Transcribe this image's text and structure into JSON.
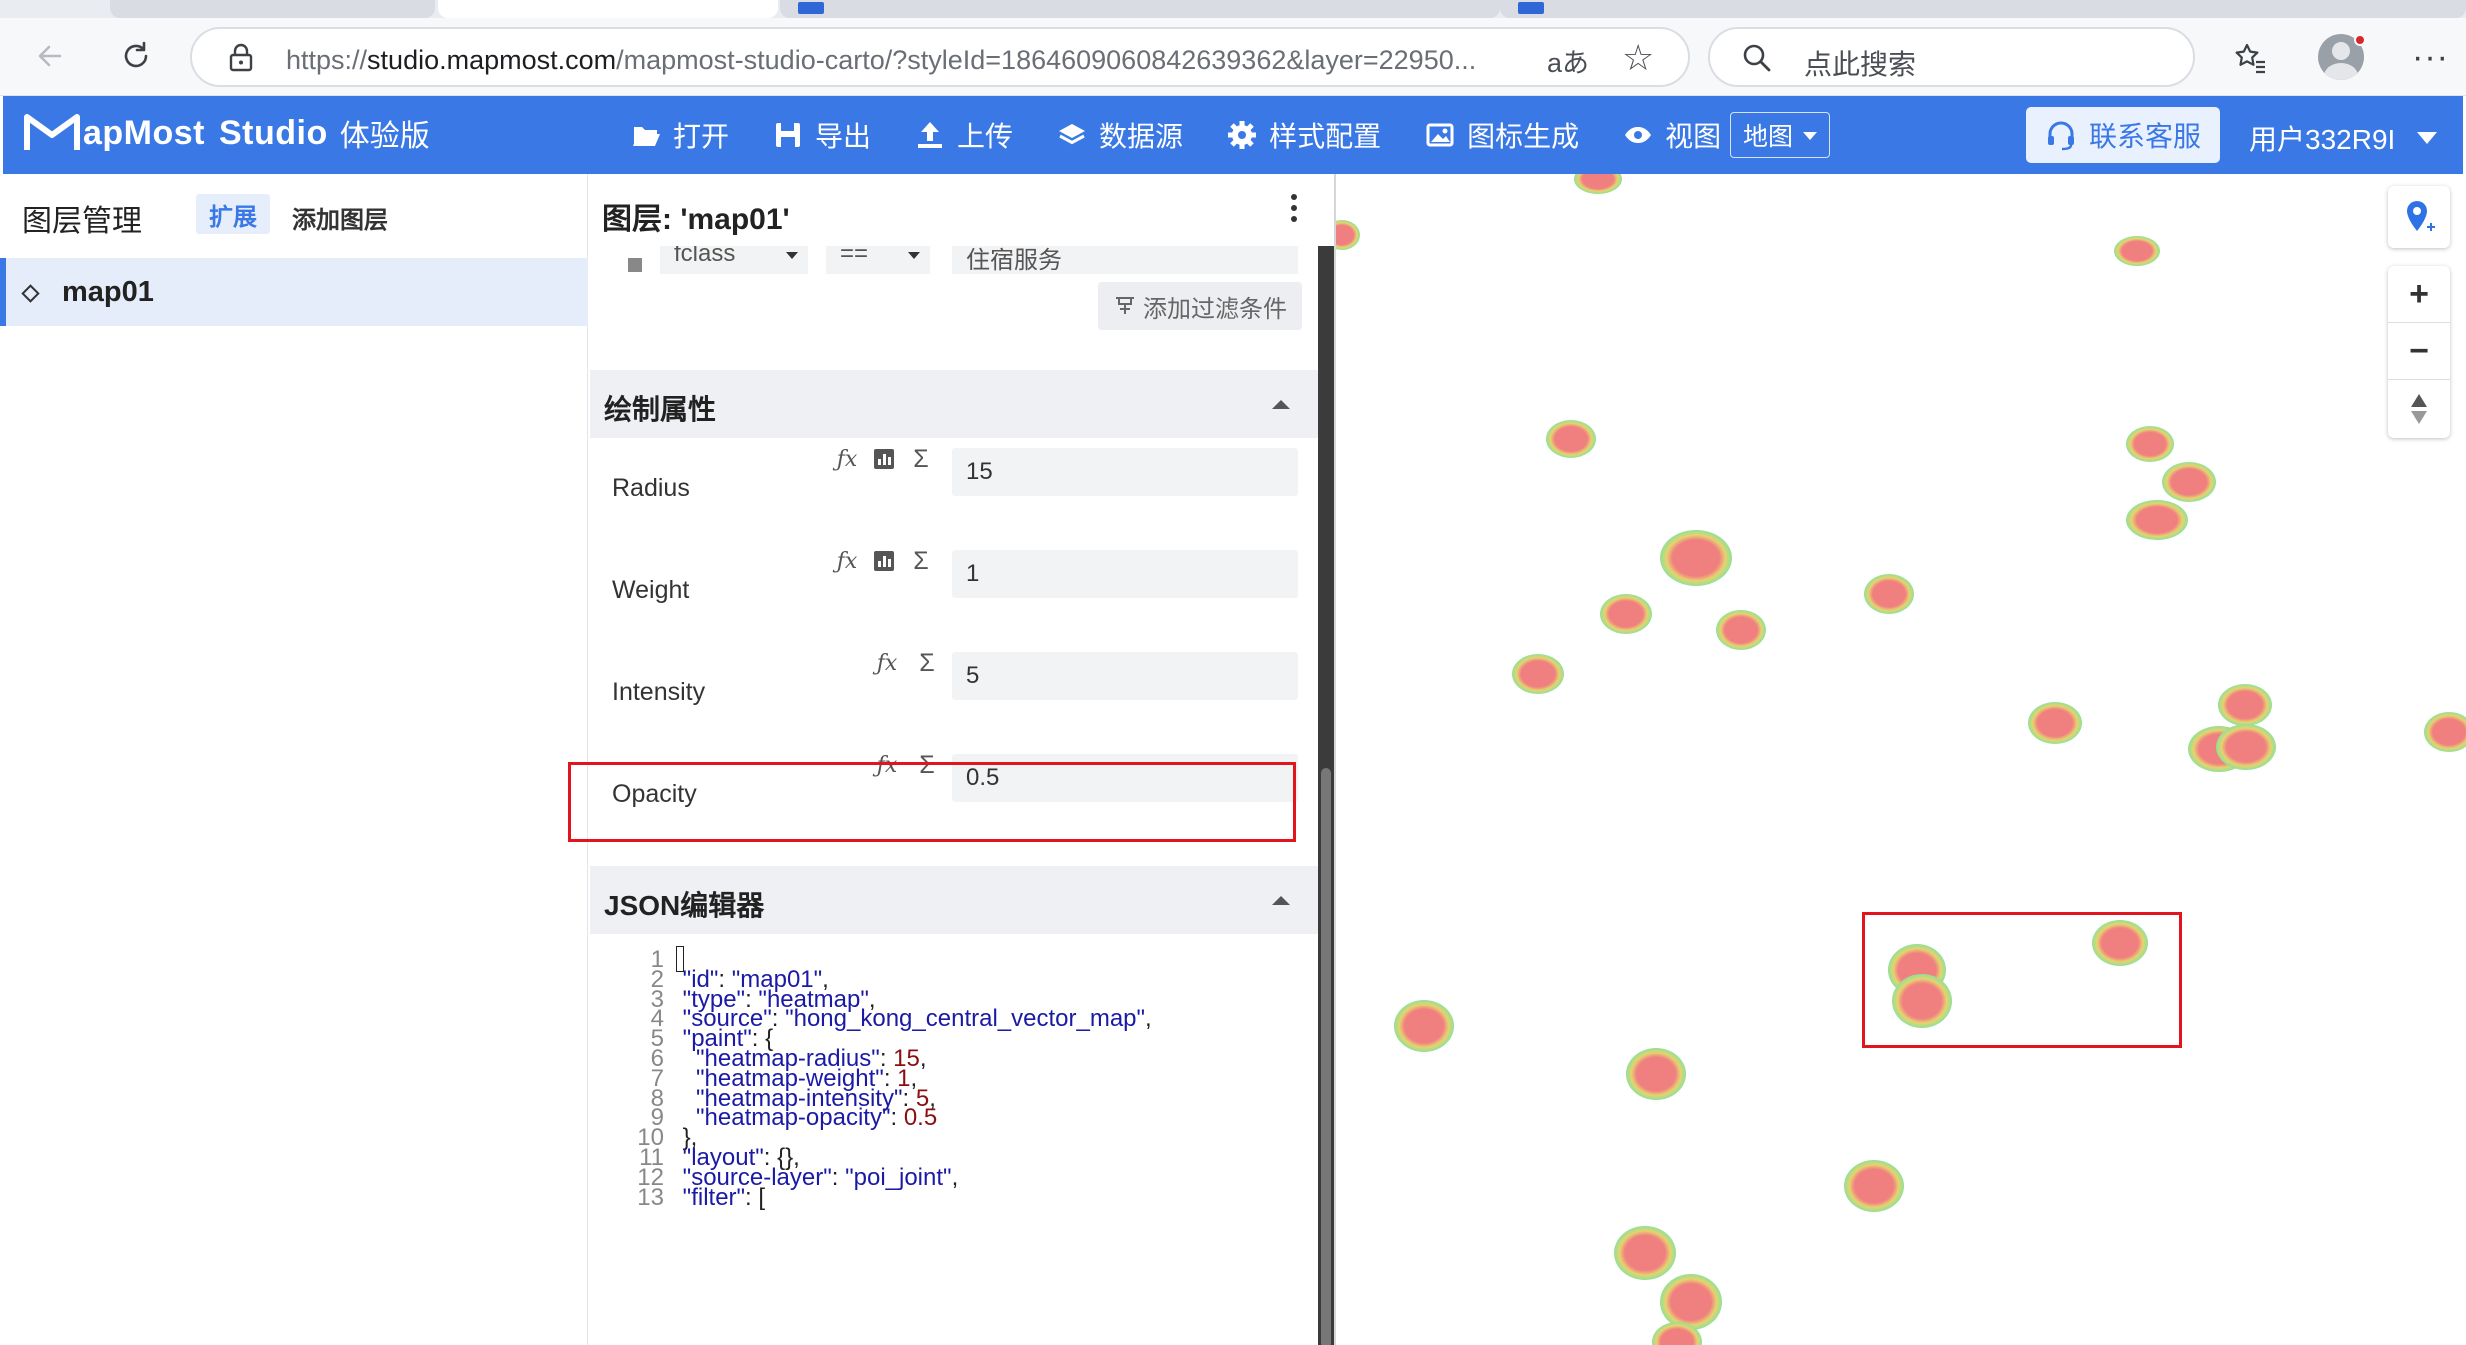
{
  "browser": {
    "url_prefix": "https://",
    "url_host": "studio.mapmost.com",
    "url_path": "/mapmost-studio-carto/?styleId=1864609060842639362&layer=22950...",
    "read_aloud": "aあ",
    "search_placeholder": "点此搜索"
  },
  "header": {
    "logo_text": "apMost",
    "logo_studio": "Studio",
    "logo_version": "体验版",
    "menu": [
      {
        "label": "打开",
        "icon": "folder-open-icon"
      },
      {
        "label": "导出",
        "icon": "save-icon"
      },
      {
        "label": "上传",
        "icon": "upload-icon"
      },
      {
        "label": "数据源",
        "icon": "layers-icon"
      },
      {
        "label": "样式配置",
        "icon": "gear-icon"
      },
      {
        "label": "图标生成",
        "icon": "image-icon"
      },
      {
        "label": "视图",
        "icon": "eye-icon"
      }
    ],
    "view_select": "地图",
    "support_label": "联系客服",
    "user_label": "用户332R9I"
  },
  "layer_panel": {
    "title": "图层管理",
    "tab_expand": "扩展",
    "tab_add": "添加图层",
    "layers": [
      {
        "name": "map01"
      }
    ]
  },
  "prop_panel": {
    "title": "图层: 'map01'",
    "filter": {
      "field": "fclass",
      "op": "==",
      "value": "住宿服务"
    },
    "add_filter": "添加过滤条件",
    "paint_section": "绘制属性",
    "props": [
      {
        "label": "Radius",
        "value": "15"
      },
      {
        "label": "Weight",
        "value": "1"
      },
      {
        "label": "Intensity",
        "value": "5"
      },
      {
        "label": "Opacity",
        "value": "0.5"
      }
    ],
    "json_section": "JSON编辑器"
  },
  "json_lines": [
    {
      "n": "1",
      "segs": [
        [
          "p",
          "{"
        ]
      ]
    },
    {
      "n": "2",
      "segs": [
        [
          "k",
          " \"id\""
        ],
        [
          "p",
          ": "
        ],
        [
          "s",
          "\"map01\""
        ],
        [
          "p",
          ","
        ]
      ]
    },
    {
      "n": "3",
      "segs": [
        [
          "k",
          " \"type\""
        ],
        [
          "p",
          ": "
        ],
        [
          "s",
          "\"heatmap\""
        ],
        [
          "p",
          ","
        ]
      ]
    },
    {
      "n": "4",
      "segs": [
        [
          "k",
          " \"source\""
        ],
        [
          "p",
          ": "
        ],
        [
          "s",
          "\"hong_kong_central_vector_map\""
        ],
        [
          "p",
          ","
        ]
      ]
    },
    {
      "n": "5",
      "segs": [
        [
          "k",
          " \"paint\""
        ],
        [
          "p",
          ": {"
        ]
      ]
    },
    {
      "n": "6",
      "segs": [
        [
          "k",
          "   \"heatmap-radius\""
        ],
        [
          "p",
          ": "
        ],
        [
          "n",
          "15"
        ],
        [
          "p",
          ","
        ]
      ]
    },
    {
      "n": "7",
      "segs": [
        [
          "k",
          "   \"heatmap-weight\""
        ],
        [
          "p",
          ": "
        ],
        [
          "n",
          "1"
        ],
        [
          "p",
          ","
        ]
      ]
    },
    {
      "n": "8",
      "segs": [
        [
          "k",
          "   \"heatmap-intensity\""
        ],
        [
          "p",
          ": "
        ],
        [
          "n",
          "5"
        ],
        [
          "p",
          ","
        ]
      ]
    },
    {
      "n": "9",
      "segs": [
        [
          "k",
          "   \"heatmap-opacity\""
        ],
        [
          "p",
          ": "
        ],
        [
          "n",
          "0.5"
        ]
      ]
    },
    {
      "n": "10",
      "segs": [
        [
          "p",
          " },"
        ]
      ]
    },
    {
      "n": "11",
      "segs": [
        [
          "k",
          " \"layout\""
        ],
        [
          "p",
          ": {},"
        ]
      ]
    },
    {
      "n": "12",
      "segs": [
        [
          "k",
          " \"source-layer\""
        ],
        [
          "p",
          ": "
        ],
        [
          "s",
          "\"poi_joint\""
        ],
        [
          "p",
          ","
        ]
      ]
    },
    {
      "n": "13",
      "segs": [
        [
          "k",
          " \"filter\""
        ],
        [
          "p",
          ": ["
        ]
      ]
    }
  ],
  "map": {
    "heat_colors": [
      "#f08080",
      "#e7d26f",
      "#9fe08c",
      "#79c9e7"
    ],
    "controls": [
      "location-pin-icon",
      "zoom-in-icon",
      "zoom-out-icon",
      "compass-icon"
    ]
  }
}
